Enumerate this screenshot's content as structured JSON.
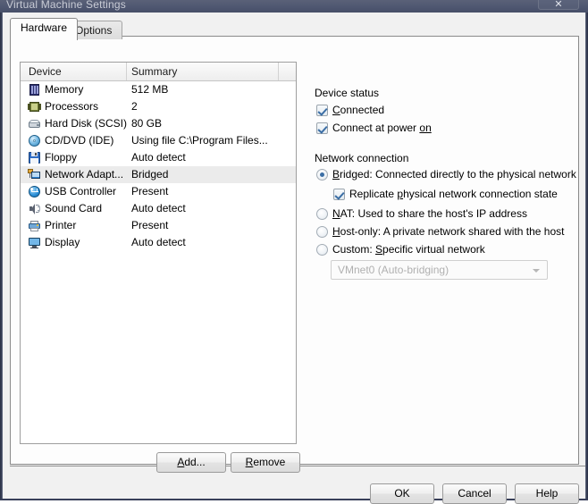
{
  "window": {
    "title": "Virtual Machine Settings",
    "close_label": "✕"
  },
  "tabs": [
    {
      "label": "Hardware",
      "active": true
    },
    {
      "label": "Options",
      "active": false
    }
  ],
  "device_list": {
    "columns": [
      "Device",
      "Summary"
    ],
    "rows": [
      {
        "icon": "memory-icon",
        "device": "Memory",
        "summary": "512 MB",
        "selected": false
      },
      {
        "icon": "processor-icon",
        "device": "Processors",
        "summary": "2",
        "selected": false
      },
      {
        "icon": "hard-disk-icon",
        "device": "Hard Disk (SCSI)",
        "summary": "80 GB",
        "selected": false
      },
      {
        "icon": "cd-dvd-icon",
        "device": "CD/DVD (IDE)",
        "summary": "Using file C:\\Program Files...",
        "selected": false
      },
      {
        "icon": "floppy-icon",
        "device": "Floppy",
        "summary": "Auto detect",
        "selected": false
      },
      {
        "icon": "network-adapter-icon",
        "device": "Network Adapt...",
        "summary": "Bridged",
        "selected": true
      },
      {
        "icon": "usb-controller-icon",
        "device": "USB Controller",
        "summary": "Present",
        "selected": false
      },
      {
        "icon": "sound-card-icon",
        "device": "Sound Card",
        "summary": "Auto detect",
        "selected": false
      },
      {
        "icon": "printer-icon",
        "device": "Printer",
        "summary": "Present",
        "selected": false
      },
      {
        "icon": "display-icon",
        "device": "Display",
        "summary": "Auto detect",
        "selected": false
      }
    ]
  },
  "list_buttons": {
    "add": {
      "accel": "A",
      "rest": "dd..."
    },
    "remove": {
      "accel": "R",
      "rest": "emove"
    }
  },
  "device_status": {
    "title": "Device status",
    "connected": {
      "pre": "",
      "accel": "C",
      "rest": "onnected",
      "checked": true
    },
    "connect_at_power_on": {
      "pre": "Connect at power ",
      "accel": "on",
      "rest": "",
      "checked": true
    }
  },
  "network_connection": {
    "title": "Network connection",
    "options": [
      {
        "accel": "B",
        "pre": "",
        "rest": "ridged: Connected directly to the physical network",
        "selected": true
      },
      {
        "accel": "N",
        "pre": "",
        "rest": "AT: Used to share the host's IP address",
        "selected": false
      },
      {
        "accel": "H",
        "pre": "",
        "rest": "ost-only: A private network shared with the host",
        "selected": false
      },
      {
        "accel": "S",
        "pre": "Custom: ",
        "rest": "pecific virtual network",
        "selected": false
      }
    ],
    "replicate": {
      "pre": "Replicate ",
      "accel": "p",
      "rest": "hysical network connection state",
      "checked": true
    },
    "vmnet_selected": "VMnet0 (Auto-bridging)"
  },
  "footer": {
    "ok": "OK",
    "cancel": "Cancel",
    "help": "Help"
  }
}
